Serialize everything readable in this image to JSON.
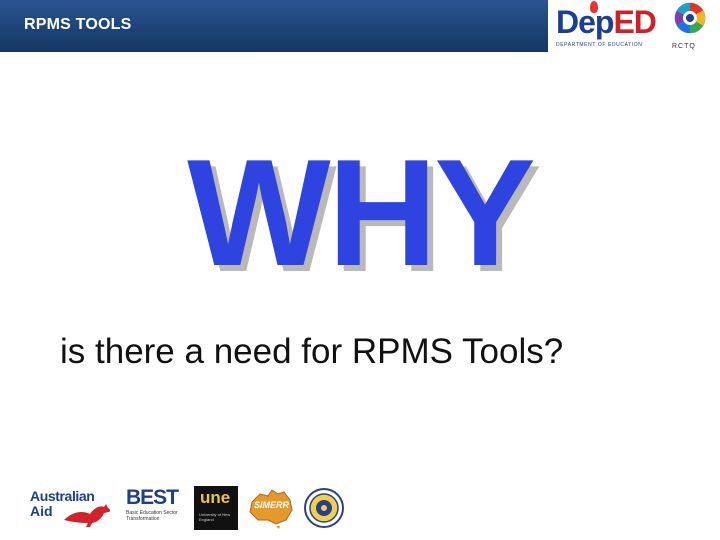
{
  "header": {
    "title": "RPMS TOOLS",
    "deped_dep": "Dep",
    "deped_ed": "ED",
    "deped_subtitle": "DEPARTMENT OF EDUCATION",
    "rctq_label": "RCTQ"
  },
  "main": {
    "headline": "WHY",
    "question": "is there a need for RPMS Tools?"
  },
  "sponsors": {
    "australian_line1": "Australian",
    "australian_line2": "Aid",
    "best_mark": "BEST",
    "best_subtitle": "Basic Education Sector Transformation",
    "une_mark": "une",
    "une_subtitle": "University of New England",
    "simerr_mark": "SiMERR"
  },
  "colors": {
    "header_bg": "#1d4379",
    "headline_blue": "#2e43e0",
    "deped_blue": "#1a3f94",
    "deped_red": "#cf2027"
  }
}
